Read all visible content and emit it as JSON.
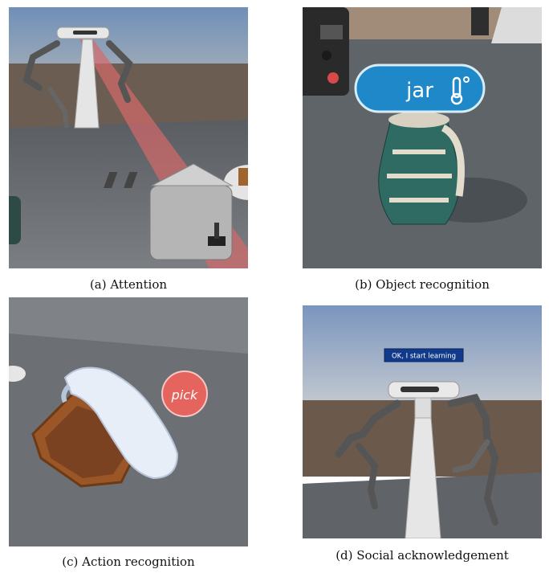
{
  "figure": {
    "panels": [
      {
        "caption": "(a) Attention"
      },
      {
        "caption": "(b) Object recognition",
        "label": "jar"
      },
      {
        "caption": "(c) Action recognition",
        "label": "pick"
      },
      {
        "caption": "(d) Social acknowledgement",
        "banner": "OK, I start learning"
      }
    ]
  }
}
